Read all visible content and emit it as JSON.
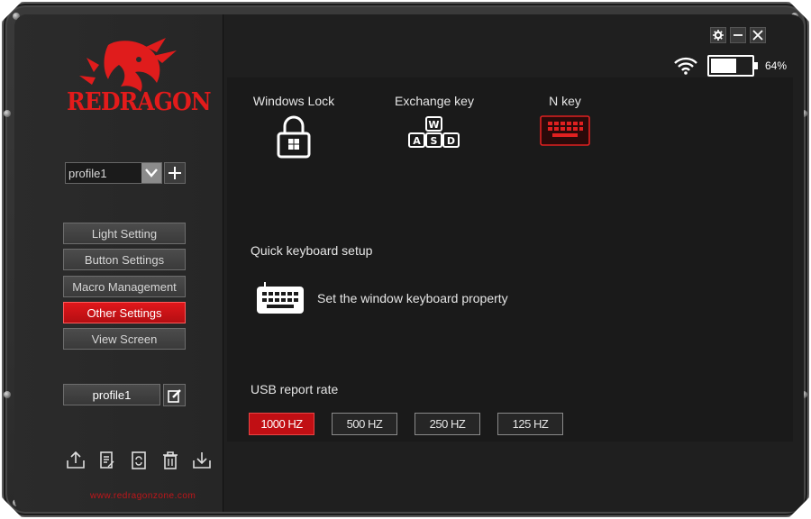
{
  "brand": {
    "name": "REDRAGON",
    "website": "www.redragonzone.com"
  },
  "profile": {
    "selected": "profile1",
    "name": "profile1"
  },
  "menu": {
    "items": [
      {
        "label": "Light Setting"
      },
      {
        "label": "Button Settings"
      },
      {
        "label": "Macro Management"
      },
      {
        "label": "Other Settings",
        "active": true
      },
      {
        "label": "View Screen"
      }
    ]
  },
  "status": {
    "battery_percent": "64%",
    "battery_level": 0.64
  },
  "features": {
    "windows_lock": "Windows Lock",
    "exchange_key": "Exchange key",
    "n_key": "N key"
  },
  "setup": {
    "heading": "Quick keyboard setup",
    "action": "Set the window keyboard property"
  },
  "usb": {
    "heading": "USB report rate",
    "rates": [
      "1000 HZ",
      "500 HZ",
      "250 HZ",
      "125 HZ"
    ],
    "selected": "1000 HZ"
  },
  "colors": {
    "accent": "#c10f14",
    "panel": "#1a1a1a",
    "frame": "#2b2b2b"
  },
  "icons": {
    "titlebar": [
      "gear-icon",
      "minimize-icon",
      "close-icon"
    ],
    "toolbar": [
      "export-icon",
      "document-icon",
      "refresh-icon",
      "trash-icon",
      "import-icon"
    ]
  }
}
